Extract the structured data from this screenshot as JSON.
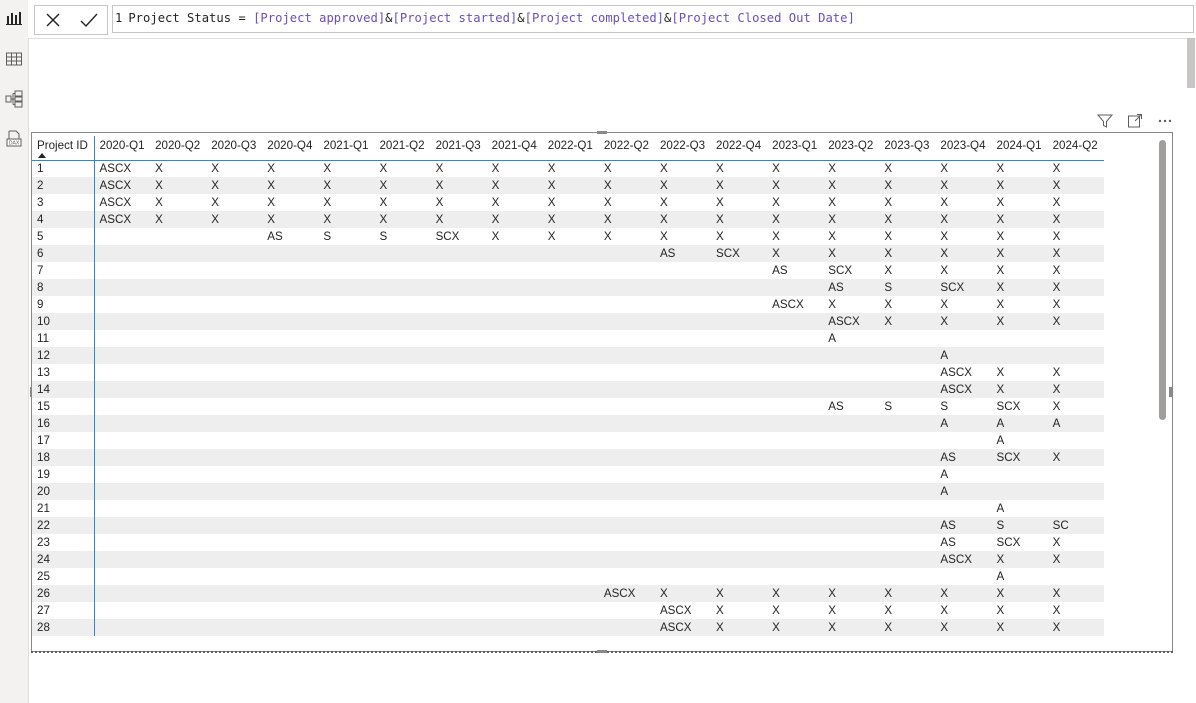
{
  "formula": {
    "line_number": "1",
    "measure_name": "Project Status",
    "operator_eq": " = ",
    "refs": [
      "[Project approved]",
      "[Project started]",
      "[Project completed]",
      "[Project Closed Out Date]"
    ],
    "amp": "&"
  },
  "icons": {
    "rail": [
      "report-view-icon",
      "table-view-icon",
      "model-view-icon",
      "dax-query-view-icon"
    ],
    "header": [
      "filter-icon",
      "focus-mode-icon",
      "more-options-icon"
    ]
  },
  "colors": {
    "accent_line": "#2b88d8",
    "ref_text": "#6b4fbb",
    "row_alt": "#eeeeee"
  },
  "matrix": {
    "id_header": "Project ID",
    "columns": [
      "2020-Q1",
      "2020-Q2",
      "2020-Q3",
      "2020-Q4",
      "2021-Q1",
      "2021-Q2",
      "2021-Q3",
      "2021-Q4",
      "2022-Q1",
      "2022-Q2",
      "2022-Q3",
      "2022-Q4",
      "2023-Q1",
      "2023-Q2",
      "2023-Q3",
      "2023-Q4",
      "2024-Q1",
      "2024-Q2"
    ],
    "rows": [
      {
        "id": "1",
        "cells": [
          "ASCX",
          "X",
          "X",
          "X",
          "X",
          "X",
          "X",
          "X",
          "X",
          "X",
          "X",
          "X",
          "X",
          "X",
          "X",
          "X",
          "X",
          "X"
        ]
      },
      {
        "id": "2",
        "cells": [
          "ASCX",
          "X",
          "X",
          "X",
          "X",
          "X",
          "X",
          "X",
          "X",
          "X",
          "X",
          "X",
          "X",
          "X",
          "X",
          "X",
          "X",
          "X"
        ]
      },
      {
        "id": "3",
        "cells": [
          "ASCX",
          "X",
          "X",
          "X",
          "X",
          "X",
          "X",
          "X",
          "X",
          "X",
          "X",
          "X",
          "X",
          "X",
          "X",
          "X",
          "X",
          "X"
        ]
      },
      {
        "id": "4",
        "cells": [
          "ASCX",
          "X",
          "X",
          "X",
          "X",
          "X",
          "X",
          "X",
          "X",
          "X",
          "X",
          "X",
          "X",
          "X",
          "X",
          "X",
          "X",
          "X"
        ]
      },
      {
        "id": "5",
        "cells": [
          "",
          "",
          "",
          "AS",
          "S",
          "S",
          "SCX",
          "X",
          "X",
          "X",
          "X",
          "X",
          "X",
          "X",
          "X",
          "X",
          "X",
          "X"
        ]
      },
      {
        "id": "6",
        "cells": [
          "",
          "",
          "",
          "",
          "",
          "",
          "",
          "",
          "",
          "",
          "AS",
          "SCX",
          "X",
          "X",
          "X",
          "X",
          "X",
          "X"
        ]
      },
      {
        "id": "7",
        "cells": [
          "",
          "",
          "",
          "",
          "",
          "",
          "",
          "",
          "",
          "",
          "",
          "",
          "AS",
          "SCX",
          "X",
          "X",
          "X",
          "X"
        ]
      },
      {
        "id": "8",
        "cells": [
          "",
          "",
          "",
          "",
          "",
          "",
          "",
          "",
          "",
          "",
          "",
          "",
          "",
          "AS",
          "S",
          "SCX",
          "X",
          "X"
        ]
      },
      {
        "id": "9",
        "cells": [
          "",
          "",
          "",
          "",
          "",
          "",
          "",
          "",
          "",
          "",
          "",
          "",
          "ASCX",
          "X",
          "X",
          "X",
          "X",
          "X"
        ]
      },
      {
        "id": "10",
        "cells": [
          "",
          "",
          "",
          "",
          "",
          "",
          "",
          "",
          "",
          "",
          "",
          "",
          "",
          "ASCX",
          "X",
          "X",
          "X",
          "X"
        ]
      },
      {
        "id": "11",
        "cells": [
          "",
          "",
          "",
          "",
          "",
          "",
          "",
          "",
          "",
          "",
          "",
          "",
          "",
          "A",
          "",
          "",
          "",
          ""
        ]
      },
      {
        "id": "12",
        "cells": [
          "",
          "",
          "",
          "",
          "",
          "",
          "",
          "",
          "",
          "",
          "",
          "",
          "",
          "",
          "",
          "A",
          "",
          ""
        ]
      },
      {
        "id": "13",
        "cells": [
          "",
          "",
          "",
          "",
          "",
          "",
          "",
          "",
          "",
          "",
          "",
          "",
          "",
          "",
          "",
          "ASCX",
          "X",
          "X"
        ]
      },
      {
        "id": "14",
        "cells": [
          "",
          "",
          "",
          "",
          "",
          "",
          "",
          "",
          "",
          "",
          "",
          "",
          "",
          "",
          "",
          "ASCX",
          "X",
          "X"
        ]
      },
      {
        "id": "15",
        "cells": [
          "",
          "",
          "",
          "",
          "",
          "",
          "",
          "",
          "",
          "",
          "",
          "",
          "",
          "AS",
          "S",
          "S",
          "SCX",
          "X"
        ]
      },
      {
        "id": "16",
        "cells": [
          "",
          "",
          "",
          "",
          "",
          "",
          "",
          "",
          "",
          "",
          "",
          "",
          "",
          "",
          "",
          "A",
          "A",
          "A"
        ]
      },
      {
        "id": "17",
        "cells": [
          "",
          "",
          "",
          "",
          "",
          "",
          "",
          "",
          "",
          "",
          "",
          "",
          "",
          "",
          "",
          "",
          "A",
          ""
        ]
      },
      {
        "id": "18",
        "cells": [
          "",
          "",
          "",
          "",
          "",
          "",
          "",
          "",
          "",
          "",
          "",
          "",
          "",
          "",
          "",
          "AS",
          "SCX",
          "X"
        ]
      },
      {
        "id": "19",
        "cells": [
          "",
          "",
          "",
          "",
          "",
          "",
          "",
          "",
          "",
          "",
          "",
          "",
          "",
          "",
          "",
          "A",
          "",
          ""
        ]
      },
      {
        "id": "20",
        "cells": [
          "",
          "",
          "",
          "",
          "",
          "",
          "",
          "",
          "",
          "",
          "",
          "",
          "",
          "",
          "",
          "A",
          "",
          ""
        ]
      },
      {
        "id": "21",
        "cells": [
          "",
          "",
          "",
          "",
          "",
          "",
          "",
          "",
          "",
          "",
          "",
          "",
          "",
          "",
          "",
          "",
          "A",
          ""
        ]
      },
      {
        "id": "22",
        "cells": [
          "",
          "",
          "",
          "",
          "",
          "",
          "",
          "",
          "",
          "",
          "",
          "",
          "",
          "",
          "",
          "AS",
          "S",
          "SC"
        ]
      },
      {
        "id": "23",
        "cells": [
          "",
          "",
          "",
          "",
          "",
          "",
          "",
          "",
          "",
          "",
          "",
          "",
          "",
          "",
          "",
          "AS",
          "SCX",
          "X"
        ]
      },
      {
        "id": "24",
        "cells": [
          "",
          "",
          "",
          "",
          "",
          "",
          "",
          "",
          "",
          "",
          "",
          "",
          "",
          "",
          "",
          "ASCX",
          "X",
          "X"
        ]
      },
      {
        "id": "25",
        "cells": [
          "",
          "",
          "",
          "",
          "",
          "",
          "",
          "",
          "",
          "",
          "",
          "",
          "",
          "",
          "",
          "",
          "A",
          ""
        ]
      },
      {
        "id": "26",
        "cells": [
          "",
          "",
          "",
          "",
          "",
          "",
          "",
          "",
          "",
          "ASCX",
          "X",
          "X",
          "X",
          "X",
          "X",
          "X",
          "X",
          "X"
        ]
      },
      {
        "id": "27",
        "cells": [
          "",
          "",
          "",
          "",
          "",
          "",
          "",
          "",
          "",
          "",
          "ASCX",
          "X",
          "X",
          "X",
          "X",
          "X",
          "X",
          "X"
        ]
      },
      {
        "id": "28",
        "cells": [
          "",
          "",
          "",
          "",
          "",
          "",
          "",
          "",
          "",
          "",
          "ASCX",
          "X",
          "X",
          "X",
          "X",
          "X",
          "X",
          "X"
        ]
      }
    ]
  }
}
